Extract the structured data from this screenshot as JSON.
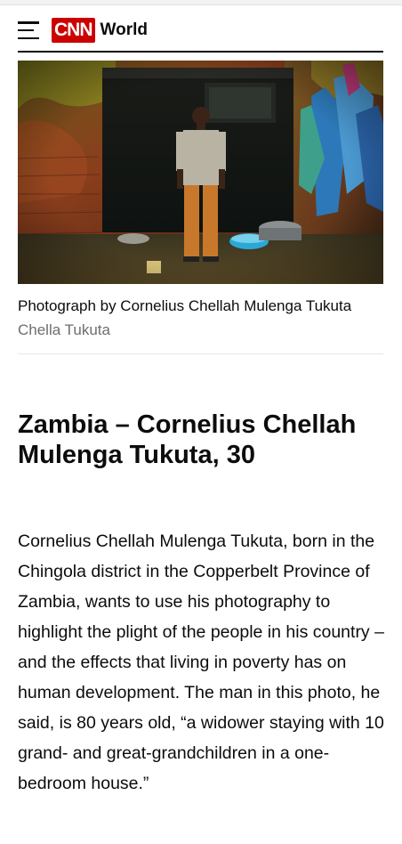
{
  "header": {
    "logo_text": "CNN",
    "section_label": "World"
  },
  "photo": {
    "alt": "Man standing in a doorway of a weathered house with washbasins and hanging laundry"
  },
  "caption": {
    "text": "Photograph by Cornelius Chellah Mulenga Tukuta",
    "credit": "Chella Tukuta"
  },
  "article": {
    "headline": "Zambia – Cornelius Chellah Mulenga Tukuta, 30",
    "body": "Cornelius Chellah Mulenga Tukuta, born in the Chingola district in the Copperbelt Province of Zambia, wants to use his photography to highlight the plight of the people in his country – and the effects that living in poverty has on human development. The man in this photo, he said, is 80 years old, “a widower staying with 10 grand- and great-grandchildren in a one-bedroom house.”"
  },
  "colors": {
    "brand": "#cc0000",
    "text": "#0c0c0c",
    "credit": "#6e6e6e"
  }
}
